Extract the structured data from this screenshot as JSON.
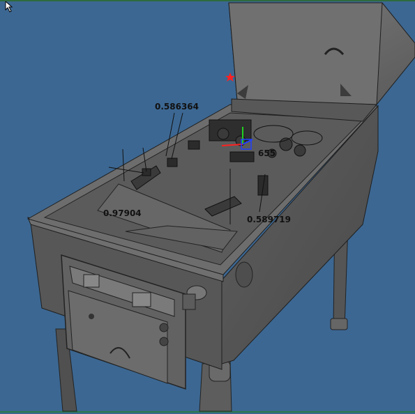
{
  "viewport": {
    "background": "#3c6792",
    "model": "pinball cabinet (shaded wireframe)"
  },
  "measurements": [
    {
      "id": "m1",
      "label": "0.586364"
    },
    {
      "id": "m2",
      "label": "0.97904"
    },
    {
      "id": "m3",
      "label": "655"
    },
    {
      "id": "m4",
      "label": "0.589719"
    }
  ],
  "gizmo": {
    "colors": {
      "x": "#ff2020",
      "y": "#20d020",
      "z": "#2040ff"
    },
    "marker_color": "#ff2020"
  },
  "icons": [
    "cursor-arrow-icon",
    "red-star-marker-icon",
    "transform-gizmo-icon"
  ]
}
